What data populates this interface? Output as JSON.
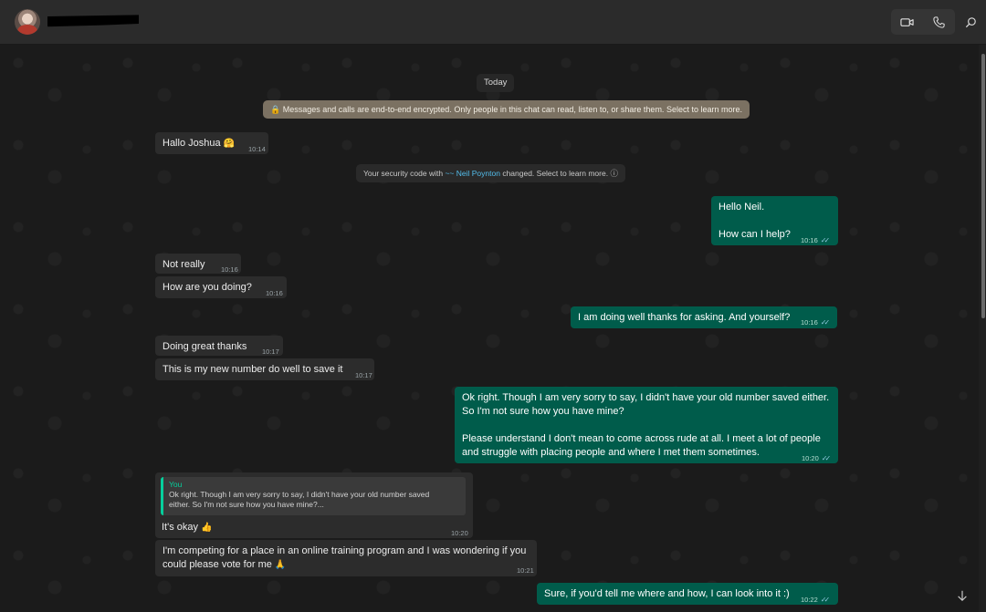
{
  "header": {
    "contact_name_redacted": true
  },
  "icons": {
    "video": "video-camera-icon",
    "phone": "phone-icon",
    "search": "search-icon",
    "lock": "lock-icon",
    "info": "info-icon",
    "scroll_down": "arrow-down-icon",
    "read_ticks": "double-check-icon"
  },
  "colors": {
    "incoming_bubble": "#2c2c2c",
    "outgoing_bubble": "#005c4b",
    "encryption_notice": "#7b7162",
    "accent": "#06cf9c",
    "link": "#53bdeb"
  },
  "chat": {
    "date_divider": "Today",
    "encryption_notice": "🔒 Messages and calls are end-to-end encrypted. Only people in this chat can read, listen to, or share them. Select to learn more.",
    "security_notice": {
      "prefix": "Your security code with ",
      "contact": "~~ Neil Poynton",
      "suffix": " changed. Select to learn more. ⓘ"
    },
    "messages": [
      {
        "direction": "in",
        "text": "Hallo Joshua",
        "emoji": "🤗",
        "time": "10:14"
      },
      {
        "direction": "out",
        "lines": [
          "Hello Neil.",
          "",
          "How can I help?"
        ],
        "time": "10:16",
        "read": true
      },
      {
        "direction": "in",
        "text": "Not really",
        "time": "10:16"
      },
      {
        "direction": "in",
        "text": "How are you doing?",
        "time": "10:16"
      },
      {
        "direction": "out",
        "text": "I am doing well thanks for asking. And yourself?",
        "time": "10:16",
        "read": true
      },
      {
        "direction": "in",
        "text": "Doing great thanks",
        "time": "10:17"
      },
      {
        "direction": "in",
        "text": "This is my new number do well to save it",
        "time": "10:17"
      },
      {
        "direction": "out",
        "lines": [
          "Ok right. Though I am very sorry to say, I didn't have your old number saved either.",
          "So I'm not sure how you have mine?",
          "",
          "Please understand I don't mean to come across rude at all. I meet a lot of people",
          "and struggle with placing people and where I met them sometimes."
        ],
        "time": "10:20",
        "read": true
      },
      {
        "direction": "in",
        "quote": {
          "author": "You",
          "line1": "Ok right. Though I am very sorry to say, I didn't have your old number saved",
          "line2": "either. So I'm not sure how you have mine?..."
        },
        "text": "It's okay",
        "emoji": "👍",
        "time": "10:20"
      },
      {
        "direction": "in",
        "lines": [
          "I'm competing for a place in an online training program and I was wondering if you",
          "could please vote for me"
        ],
        "emoji": "🙏",
        "time": "10:21"
      },
      {
        "direction": "out",
        "text": "Sure, if you'd tell me where and how, I can look into it :)",
        "time": "10:22",
        "read": true
      }
    ]
  }
}
